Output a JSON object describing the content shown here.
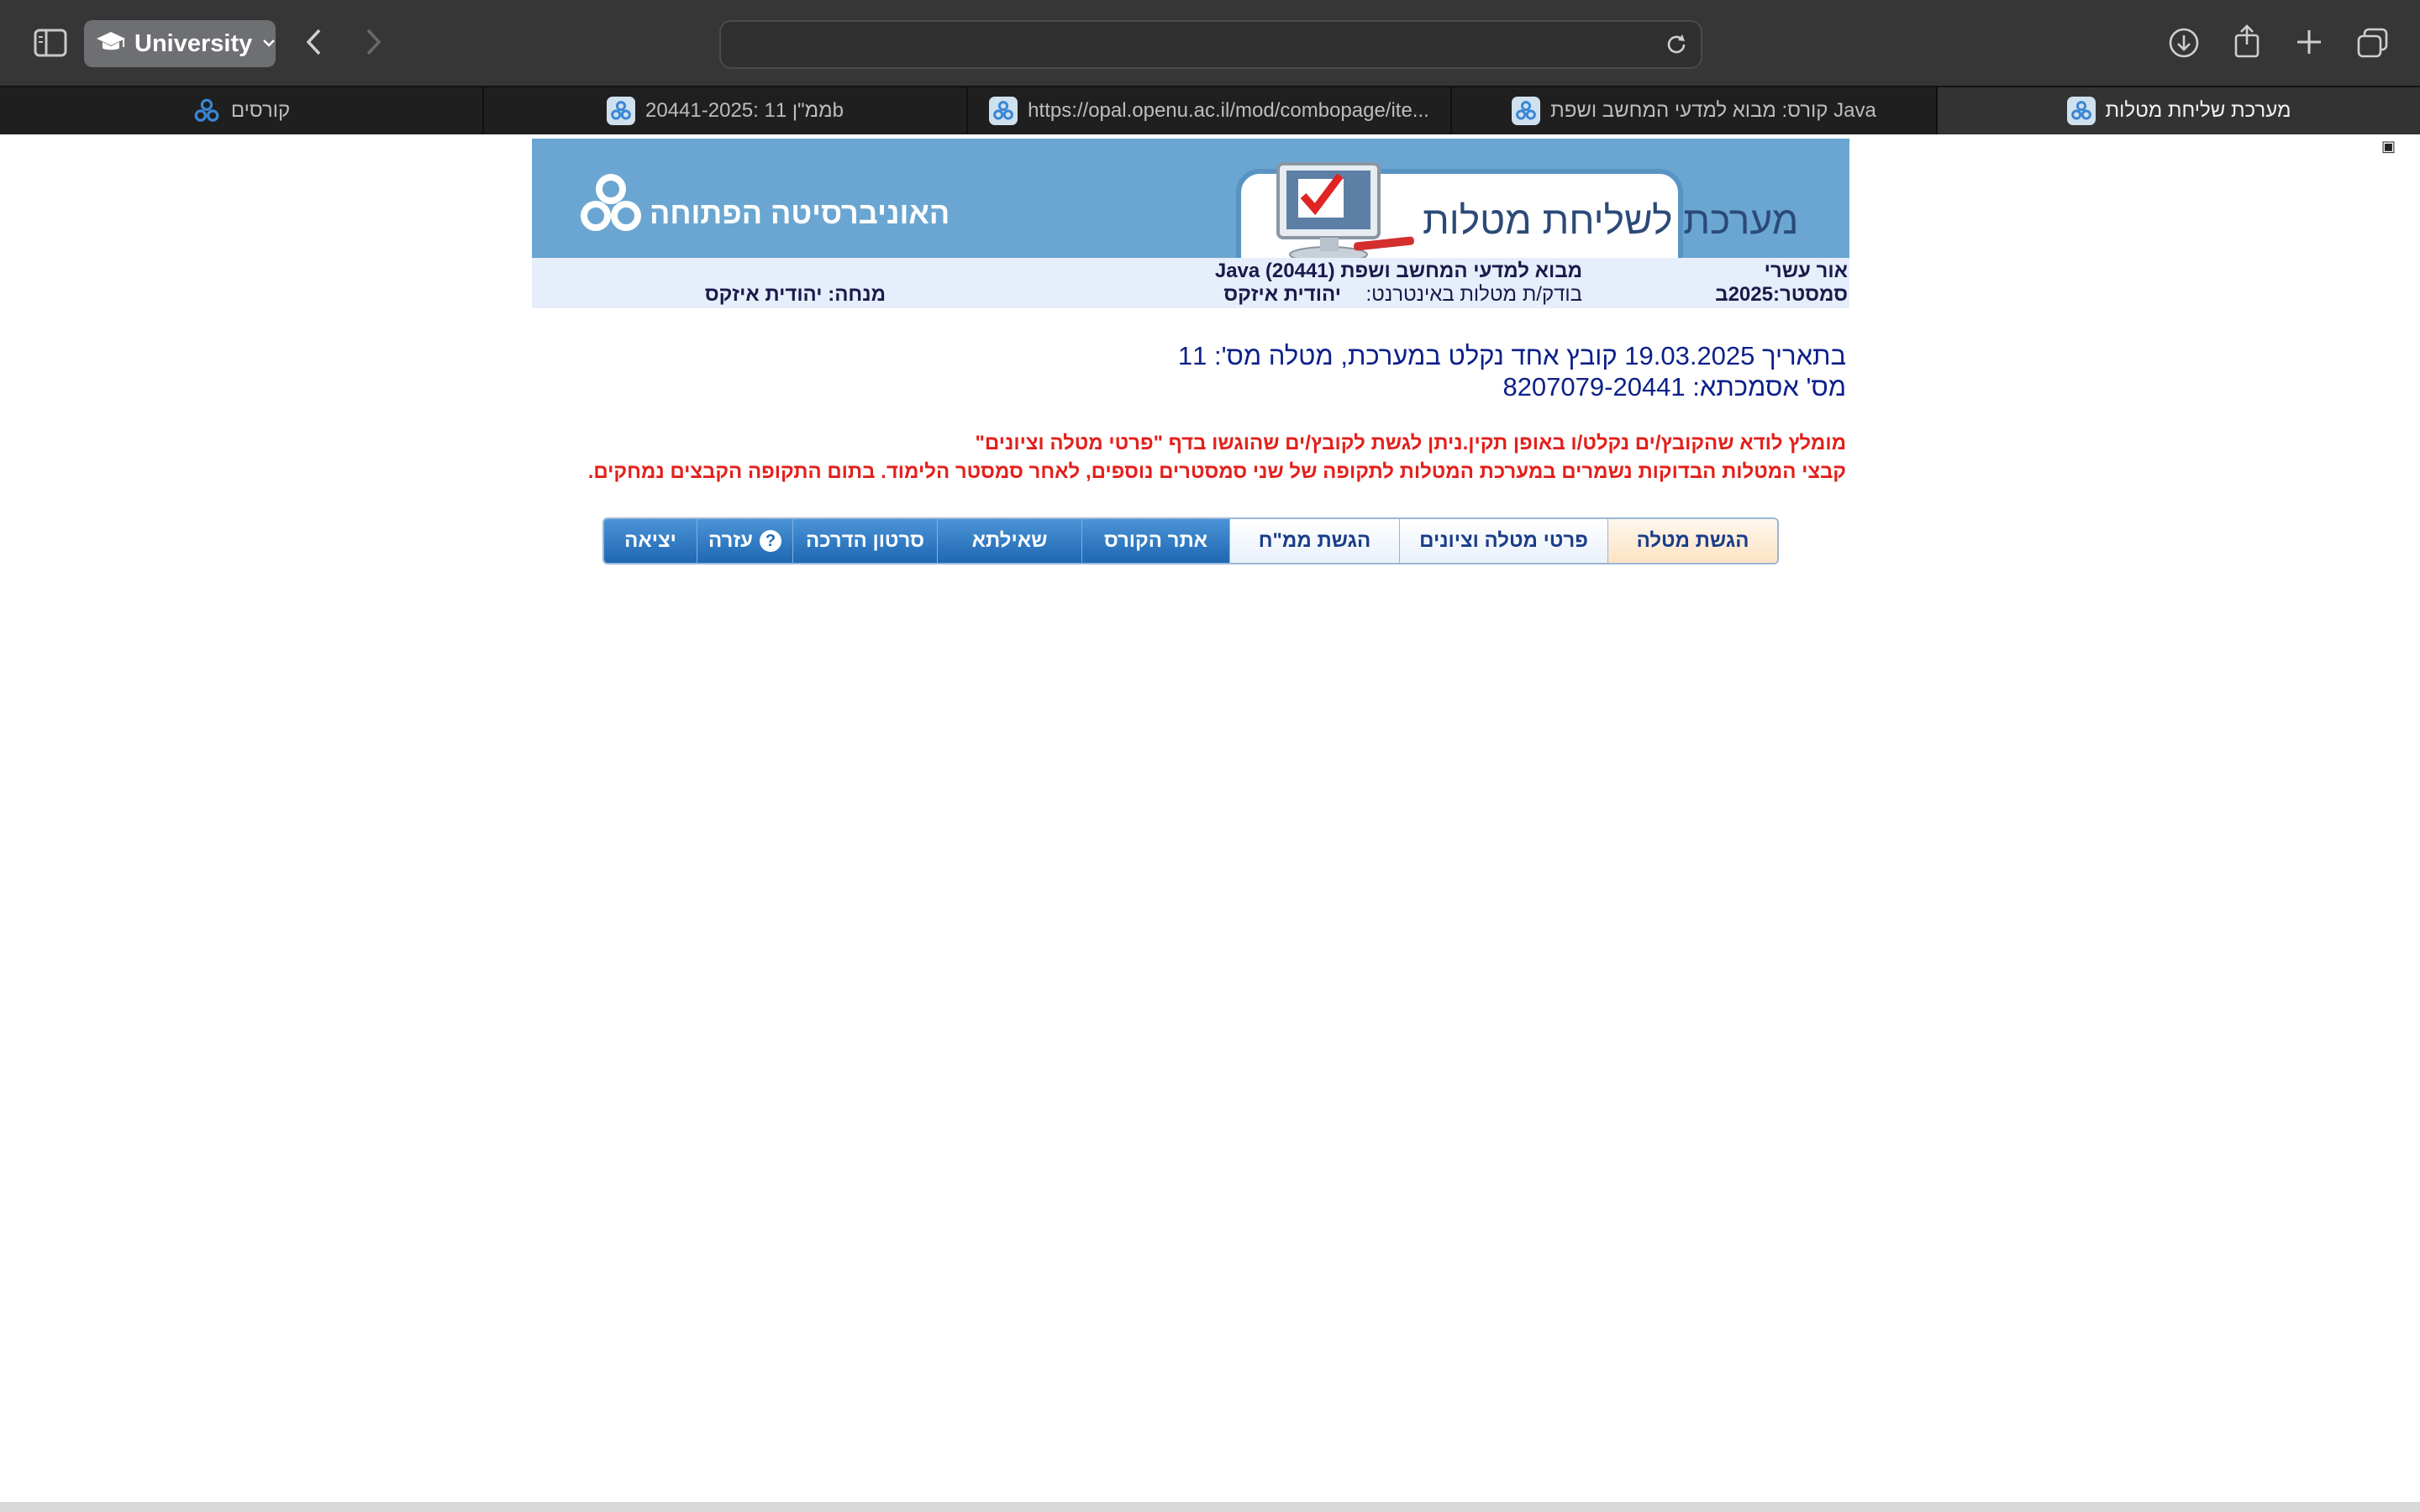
{
  "browser": {
    "profile_name": "University",
    "tabs": [
      {
        "label": "קורסים",
        "active": false
      },
      {
        "label": "ממ\"ן 11 :20441-2025b",
        "active": false
      },
      {
        "label": "https://opal.openu.ac.il/mod/combopage/ite...",
        "active": false
      },
      {
        "label": "קורס: מבוא למדעי המחשב ושפת Java",
        "active": false
      },
      {
        "label": "מערכת שליחת מטלות",
        "active": true
      }
    ]
  },
  "header": {
    "org_name": "האוניברסיטה הפתוחה",
    "system_title": "מערכת לשליחת מטלות"
  },
  "info": {
    "student_name": "אור עשרי",
    "semester": "סמסטר:2025ב",
    "course": "מבוא למדעי המחשב ושפת Java (20441)",
    "checker_label": "בודק/ת מטלות באינטרנט:",
    "checker_name": "יהודית איזקס",
    "tutor": "מנחה: יהודית איזקס"
  },
  "message": {
    "line1": "בתאריך 19.03.2025 קובץ אחד נקלט במערכת, מטלה מס': 11",
    "line2": "מס' אסמכתא: 8207079-20441",
    "warning1": "מומלץ לודא שהקובץ/ים נקלט/ו באופן תקין.ניתן לגשת לקובץ/ים שהוגשו בדף \"פרטי מטלה וציונים\"",
    "warning2": "קבצי המטלות הבדוקות נשמרים במערכת המטלות לתקופה של שני סמסטרים נוספים, לאחר סמסטר הלימוד. בתום התקופה הקבצים נמחקים."
  },
  "nav": {
    "submit_assignment": "הגשת מטלה",
    "assignment_details": "פרטי מטלה וציונים",
    "submit_mmh": "הגשת ממ\"ח",
    "course_site": "אתר הקורס",
    "question": "שאילתא",
    "tutorial_video": "סרטון הדרכה",
    "help": "עזרה",
    "exit": "יציאה"
  },
  "colors": {
    "banner_blue": "#6aa6d1",
    "nav_dark_blue": "#1e68b3",
    "warning_red": "#e3201b",
    "message_blue": "#0c1f8a"
  }
}
